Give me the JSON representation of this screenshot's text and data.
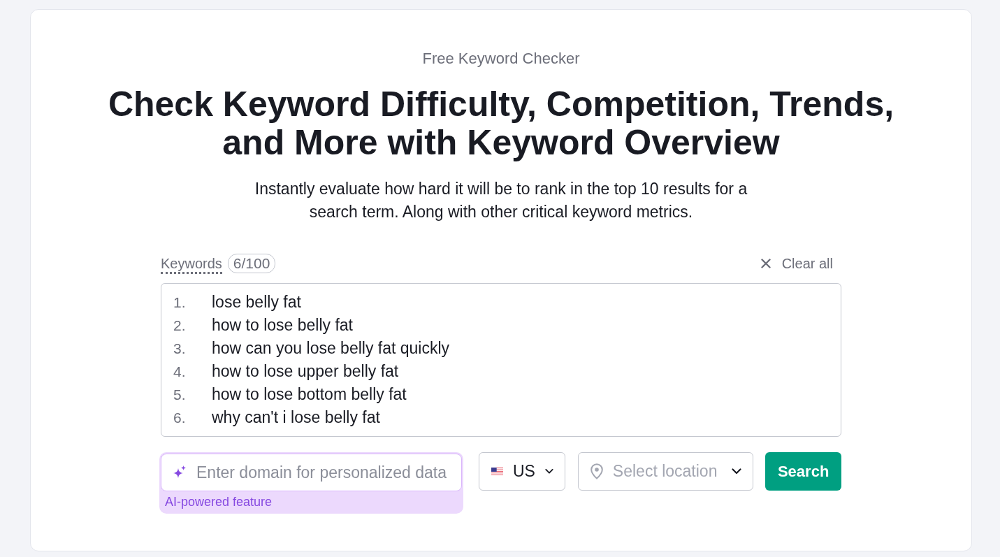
{
  "header": {
    "eyebrow": "Free Keyword Checker",
    "title": "Check Keyword Difficulty, Competition, Trends, and More with Keyword Overview",
    "subtitle": "Instantly evaluate how hard it will be to rank in the top 10 results for a search term. Along with other critical keyword metrics."
  },
  "keywords": {
    "label": "Keywords",
    "count": "6/100",
    "clear_button": "Clear all",
    "items": [
      {
        "number": "1.",
        "text": "lose belly fat"
      },
      {
        "number": "2.",
        "text": "how to lose belly fat"
      },
      {
        "number": "3.",
        "text": "how can you lose belly fat quickly"
      },
      {
        "number": "4.",
        "text": "how to lose upper belly fat"
      },
      {
        "number": "5.",
        "text": "how to lose bottom belly fat"
      },
      {
        "number": "6.",
        "text": "why can't i lose belly fat"
      }
    ]
  },
  "domain_field": {
    "placeholder": "Enter domain for personalized data",
    "note": "AI-powered feature"
  },
  "country_select": {
    "value": "US"
  },
  "location_select": {
    "placeholder": "Select location"
  },
  "search_button": {
    "label": "Search"
  }
}
